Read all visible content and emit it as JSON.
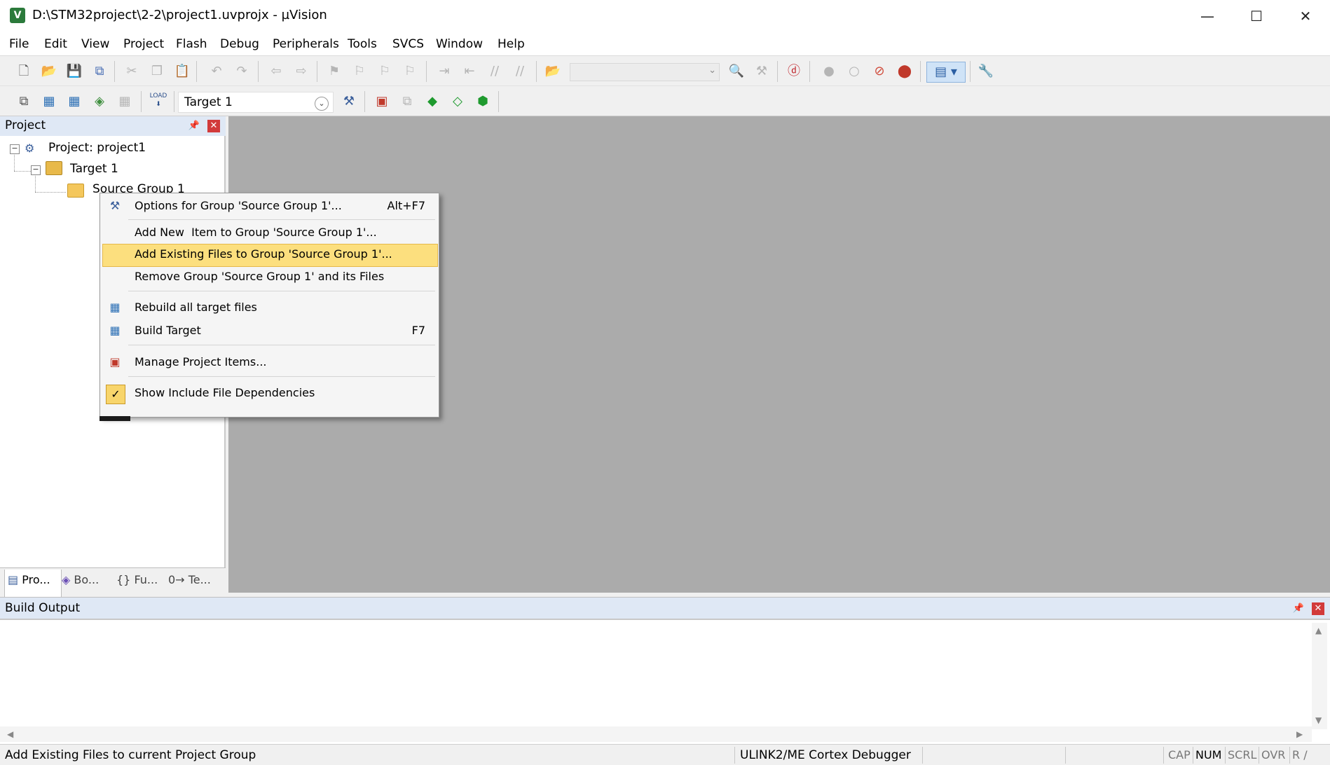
{
  "window": {
    "title": "D:\\STM32project\\2-2\\project1.uvprojx - µVision",
    "app_icon": "uvision-icon",
    "controls": {
      "minimize": "—",
      "maximize": "☐",
      "close": "✕"
    }
  },
  "menubar": {
    "items": [
      "File",
      "Edit",
      "View",
      "Project",
      "Flash",
      "Debug",
      "Peripherals",
      "Tools",
      "SVCS",
      "Window",
      "Help"
    ]
  },
  "toolbar2": {
    "target_value": "Target 1",
    "load_label": "LOAD"
  },
  "project_panel": {
    "title": "Project",
    "tree": {
      "project": "Project: project1",
      "target": "Target 1",
      "group": "Source Group 1"
    },
    "tabs": [
      "Pro...",
      "Bo...",
      "Fu...",
      "Te..."
    ]
  },
  "context_menu": {
    "items": [
      {
        "label": "Options for Group 'Source Group 1'...",
        "shortcut": "Alt+F7",
        "icon": "options-wand-icon"
      },
      {
        "label": "Add New  Item to Group 'Source Group 1'...",
        "shortcut": ""
      },
      {
        "label": "Add Existing Files to Group 'Source Group 1'...",
        "shortcut": "",
        "highlighted": true
      },
      {
        "label": "Remove Group 'Source Group 1' and its Files",
        "shortcut": ""
      },
      {
        "label": "Rebuild all target files",
        "shortcut": "",
        "icon": "rebuild-icon"
      },
      {
        "label": "Build Target",
        "shortcut": "F7",
        "icon": "build-icon"
      },
      {
        "label": "Manage Project Items...",
        "shortcut": "",
        "icon": "manage-items-icon"
      },
      {
        "label": "Show Include File Dependencies",
        "shortcut": "",
        "icon": "checkmark-icon",
        "checked": true
      }
    ],
    "highlight_color": "#fcdf7e"
  },
  "build_output": {
    "title": "Build Output",
    "content": ""
  },
  "statusbar": {
    "message": "Add Existing Files to current Project Group",
    "debugger": "ULINK2/ME Cortex Debugger",
    "indicators": {
      "cap": "CAP",
      "num": "NUM",
      "scrl": "SCRL",
      "ovr": "OVR",
      "rw": "R /"
    }
  },
  "colors": {
    "panel_header": "#dfe8f5",
    "editor_bg": "#ababab",
    "close_red": "#d23a3a"
  }
}
